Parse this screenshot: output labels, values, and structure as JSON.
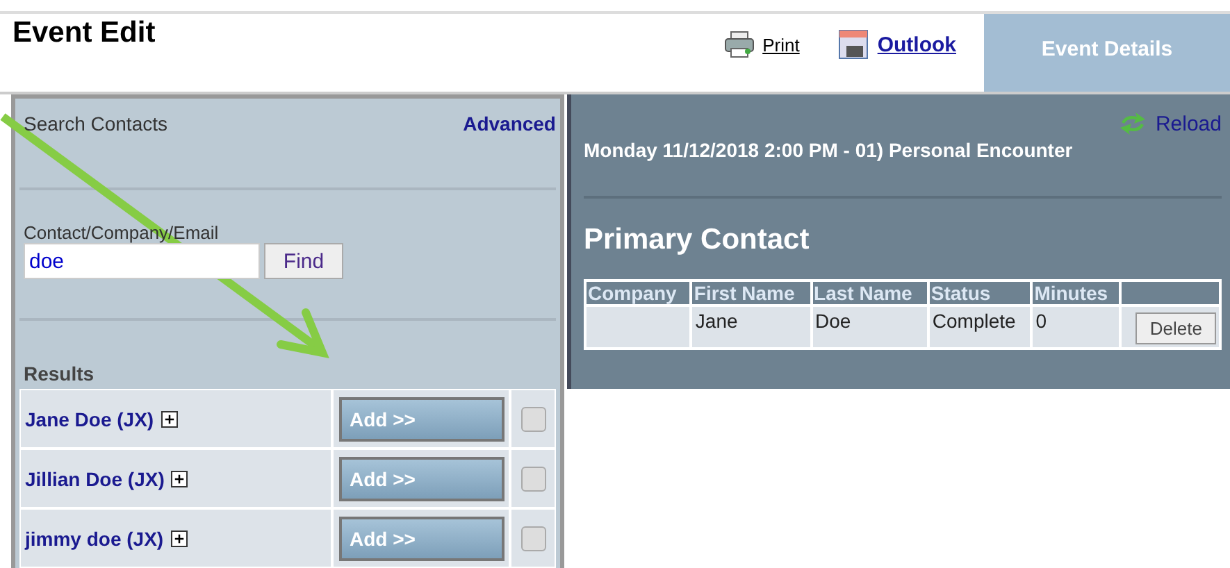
{
  "title": "Event Edit",
  "toolbar": [
    {
      "kind": "print",
      "label": "Print"
    },
    {
      "kind": "outlook",
      "label": "Outlook"
    }
  ],
  "tab": {
    "label": "Event Details",
    "selected": true
  },
  "search": {
    "heading": "Search Contacts",
    "advanced": "Advanced",
    "field_label": "Contact/Company/Email",
    "value": "doe",
    "find": "Find"
  },
  "results": {
    "heading": "Results",
    "rows": [
      {
        "name": "Jane Doe (JX)",
        "add": "Add >>",
        "checked": false
      },
      {
        "name": "Jillian Doe (JX)",
        "add": "Add >>",
        "checked": false
      },
      {
        "name": "jimmy doe (JX)",
        "add": "Add >>",
        "checked": false
      }
    ]
  },
  "details": {
    "reload": "Reload",
    "event": "Monday 11/12/2018 2:00 PM - 01) Personal Encounter",
    "section": "Primary Contact",
    "columns": [
      "Company",
      "First Name",
      "Last Name",
      "Status",
      "Minutes"
    ],
    "rows": [
      {
        "cells": [
          "",
          "Jane",
          "Doe",
          "Complete",
          "0"
        ],
        "action": "Delete"
      }
    ]
  }
}
